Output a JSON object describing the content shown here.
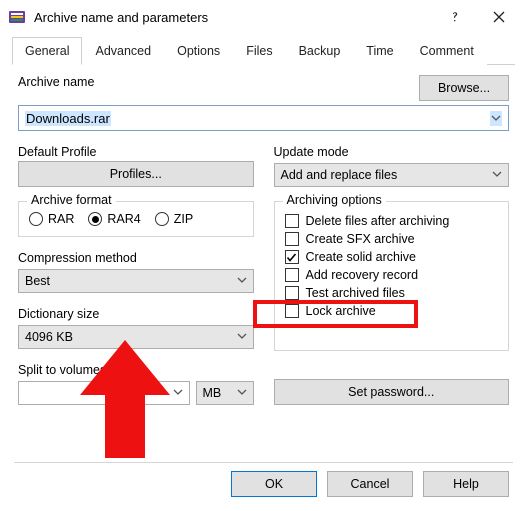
{
  "window": {
    "title": "Archive name and parameters"
  },
  "tabs": {
    "general": "General",
    "advanced": "Advanced",
    "options": "Options",
    "files": "Files",
    "backup": "Backup",
    "time": "Time",
    "comment": "Comment"
  },
  "labels": {
    "archive_name": "Archive name",
    "browse": "Browse...",
    "default_profile": "Default Profile",
    "profiles": "Profiles...",
    "update_mode": "Update mode",
    "archive_format": "Archive format",
    "compression_method": "Compression method",
    "dictionary_size": "Dictionary size",
    "split_to_volumes": "Split to volumes, size",
    "archiving_options": "Archiving options",
    "set_password": "Set password...",
    "ok": "OK",
    "cancel": "Cancel",
    "help": "Help"
  },
  "values": {
    "archive_name": "Downloads.rar",
    "update_mode": "Add and replace files",
    "compression_method": "Best",
    "dictionary_size": "4096 KB",
    "split_value": "",
    "split_unit": "MB"
  },
  "formats": {
    "rar": "RAR",
    "rar4": "RAR4",
    "zip": "ZIP"
  },
  "options": {
    "delete_after": "Delete files after archiving",
    "create_sfx": "Create SFX archive",
    "create_solid": "Create solid archive",
    "add_recovery": "Add recovery record",
    "test_archived": "Test archived files",
    "lock_archive": "Lock archive"
  }
}
